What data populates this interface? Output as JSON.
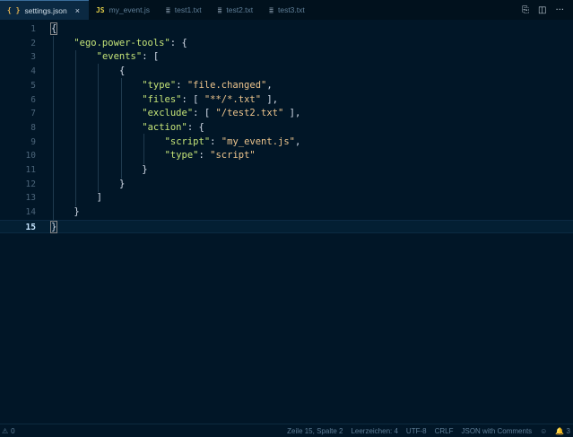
{
  "tabs": [
    {
      "icon": "{ }",
      "label": "settings.json",
      "active": true,
      "close": "×"
    },
    {
      "icon": "JS",
      "label": "my_event.js",
      "active": false
    },
    {
      "icon": "≣",
      "label": "test1.txt",
      "active": false
    },
    {
      "icon": "≣",
      "label": "test2.txt",
      "active": false
    },
    {
      "icon": "≣",
      "label": "test3.txt",
      "active": false
    }
  ],
  "tab_actions": {
    "open_changes": "⎘",
    "split_editor": "◫",
    "more": "···"
  },
  "editor": {
    "line_numbers": [
      "1",
      "2",
      "3",
      "4",
      "5",
      "6",
      "7",
      "8",
      "9",
      "10",
      "11",
      "12",
      "13",
      "14",
      "15"
    ],
    "current_line": 15,
    "lines": [
      "{",
      "    \"ego.power-tools\": {",
      "        \"events\": [",
      "            {",
      "                \"type\": \"file.changed\",",
      "                \"files\": [ \"**/*.txt\" ],",
      "                \"exclude\": [ \"/test2.txt\" ],",
      "                \"action\": {",
      "                    \"script\": \"my_event.js\",",
      "                    \"type\": \"script\"",
      "                }",
      "            }",
      "        ]",
      "    }",
      "}"
    ],
    "colors": {
      "background": "#011627",
      "key": "#c5e478",
      "string": "#ecc48d",
      "punct": "#d6deeb"
    }
  },
  "status": {
    "problems_icon": "⚠",
    "problems_count": "0",
    "position": "Zeile 15, Spalte 2",
    "indent": "Leerzeichen: 4",
    "encoding": "UTF-8",
    "eol": "CRLF",
    "language": "JSON with Comments",
    "feedback_icon": "☺",
    "notifications_icon": "🔔",
    "notifications_count": "3"
  }
}
